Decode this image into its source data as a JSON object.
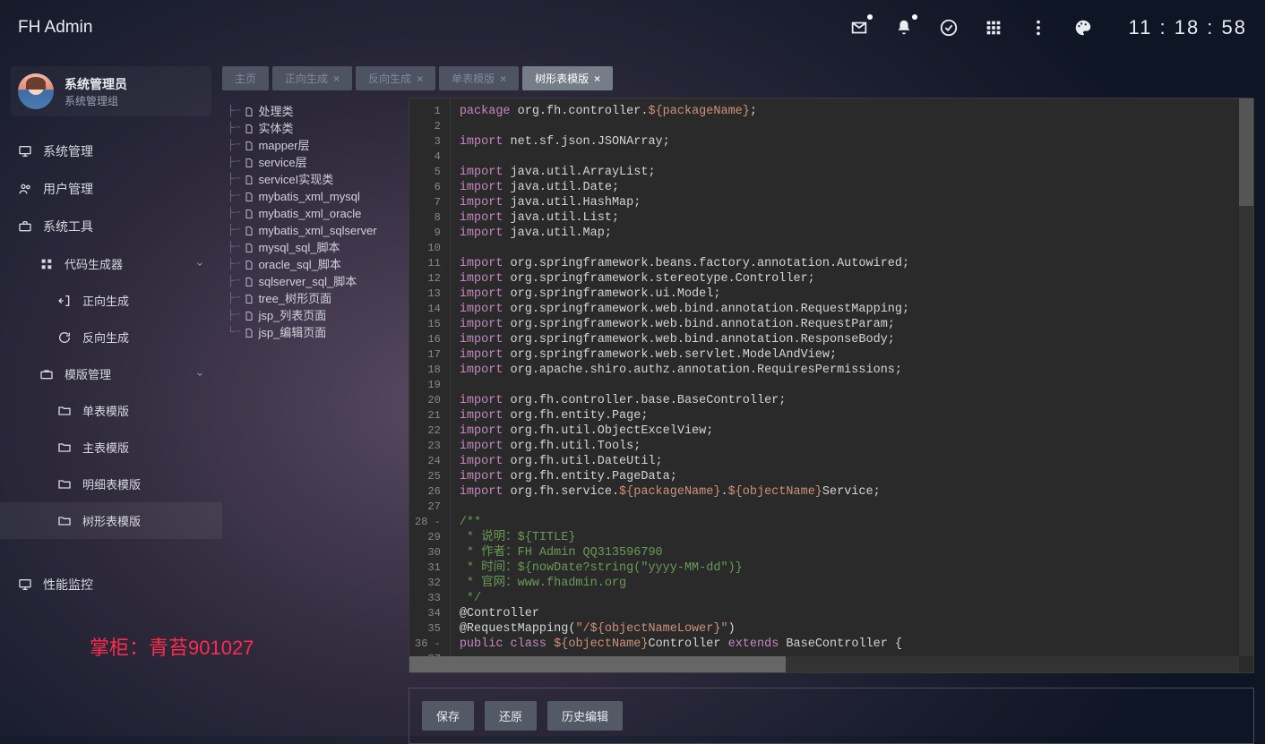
{
  "brand": "FH Admin",
  "clock": "11 : 18 : 58",
  "user": {
    "name": "系统管理员",
    "group": "系统管理组"
  },
  "nav": [
    {
      "icon": "monitor",
      "label": "系统管理"
    },
    {
      "icon": "users",
      "label": "用户管理"
    },
    {
      "icon": "briefcase",
      "label": "系统工具"
    },
    {
      "icon": "grid",
      "label": "代码生成器",
      "lvl": 2,
      "exp": true
    },
    {
      "icon": "exit",
      "label": "正向生成",
      "lvl": 3
    },
    {
      "icon": "refresh",
      "label": "反向生成",
      "lvl": 3
    },
    {
      "icon": "case",
      "label": "模版管理",
      "lvl": 2,
      "exp": true
    },
    {
      "icon": "folder",
      "label": "单表模版",
      "lvl": 3
    },
    {
      "icon": "folder",
      "label": "主表模版",
      "lvl": 3
    },
    {
      "icon": "folder",
      "label": "明细表模版",
      "lvl": 3
    },
    {
      "icon": "folder",
      "label": "树形表模版",
      "lvl": 3,
      "active": true
    },
    {
      "icon": "monitor",
      "label": "性能监控",
      "gap": true
    }
  ],
  "tabs": [
    {
      "label": "主页",
      "closable": false,
      "state": "dead"
    },
    {
      "label": "正向生成",
      "closable": true,
      "state": "dead"
    },
    {
      "label": "反向生成",
      "closable": true,
      "state": "dead"
    },
    {
      "label": "单表模版",
      "closable": true,
      "state": "dead"
    },
    {
      "label": "树形表模版",
      "closable": true,
      "state": "active"
    }
  ],
  "tree": [
    "处理类",
    "实体类",
    "mapper层",
    "service层",
    "serviceI实现类",
    "mybatis_xml_mysql",
    "mybatis_xml_oracle",
    "mybatis_xml_sqlserver",
    "mysql_sql_脚本",
    "oracle_sql_脚本",
    "sqlserver_sql_脚本",
    "tree_树形页面",
    "jsp_列表页面",
    "jsp_编辑页面"
  ],
  "code": {
    "lines": [
      [
        [
          "kw",
          "package"
        ],
        [
          "id",
          " org.fh.controller."
        ],
        [
          "tmpl",
          "${packageName}"
        ],
        [
          "id",
          ";"
        ]
      ],
      [],
      [
        [
          "kw",
          "import"
        ],
        [
          "id",
          " net.sf.json.JSONArray;"
        ]
      ],
      [],
      [
        [
          "kw",
          "import"
        ],
        [
          "id",
          " java.util.ArrayList;"
        ]
      ],
      [
        [
          "kw",
          "import"
        ],
        [
          "id",
          " java.util.Date;"
        ]
      ],
      [
        [
          "kw",
          "import"
        ],
        [
          "id",
          " java.util.HashMap;"
        ]
      ],
      [
        [
          "kw",
          "import"
        ],
        [
          "id",
          " java.util.List;"
        ]
      ],
      [
        [
          "kw",
          "import"
        ],
        [
          "id",
          " java.util.Map;"
        ]
      ],
      [],
      [
        [
          "kw",
          "import"
        ],
        [
          "id",
          " org.springframework.beans.factory.annotation.Autowired;"
        ]
      ],
      [
        [
          "kw",
          "import"
        ],
        [
          "id",
          " org.springframework.stereotype.Controller;"
        ]
      ],
      [
        [
          "kw",
          "import"
        ],
        [
          "id",
          " org.springframework.ui.Model;"
        ]
      ],
      [
        [
          "kw",
          "import"
        ],
        [
          "id",
          " org.springframework.web.bind.annotation.RequestMapping;"
        ]
      ],
      [
        [
          "kw",
          "import"
        ],
        [
          "id",
          " org.springframework.web.bind.annotation.RequestParam;"
        ]
      ],
      [
        [
          "kw",
          "import"
        ],
        [
          "id",
          " org.springframework.web.bind.annotation.ResponseBody;"
        ]
      ],
      [
        [
          "kw",
          "import"
        ],
        [
          "id",
          " org.springframework.web.servlet.ModelAndView;"
        ]
      ],
      [
        [
          "kw",
          "import"
        ],
        [
          "id",
          " org.apache.shiro.authz.annotation.RequiresPermissions;"
        ]
      ],
      [],
      [
        [
          "kw",
          "import"
        ],
        [
          "id",
          " org.fh.controller.base.BaseController;"
        ]
      ],
      [
        [
          "kw",
          "import"
        ],
        [
          "id",
          " org.fh.entity.Page;"
        ]
      ],
      [
        [
          "kw",
          "import"
        ],
        [
          "id",
          " org.fh.util.ObjectExcelView;"
        ]
      ],
      [
        [
          "kw",
          "import"
        ],
        [
          "id",
          " org.fh.util.Tools;"
        ]
      ],
      [
        [
          "kw",
          "import"
        ],
        [
          "id",
          " org.fh.util.DateUtil;"
        ]
      ],
      [
        [
          "kw",
          "import"
        ],
        [
          "id",
          " org.fh.entity.PageData;"
        ]
      ],
      [
        [
          "kw",
          "import"
        ],
        [
          "id",
          " org.fh.service."
        ],
        [
          "tmpl",
          "${packageName}"
        ],
        [
          "id",
          "."
        ],
        [
          "tmpl",
          "${objectName}"
        ],
        [
          "id",
          "Service;"
        ]
      ],
      [],
      [
        [
          "cmt",
          "/**"
        ]
      ],
      [
        [
          "cmt",
          " * 说明：${TITLE}"
        ]
      ],
      [
        [
          "cmt",
          " * 作者：FH Admin QQ313596790"
        ]
      ],
      [
        [
          "cmt",
          " * 时间：${nowDate?string(\"yyyy-MM-dd\")}"
        ]
      ],
      [
        [
          "cmt",
          " * 官网：www.fhadmin.org"
        ]
      ],
      [
        [
          "cmt",
          " */"
        ]
      ],
      [
        [
          "ann",
          "@Controller"
        ]
      ],
      [
        [
          "ann",
          "@RequestMapping("
        ],
        [
          "str",
          "\"/"
        ],
        [
          "tmpl",
          "${objectNameLower}"
        ],
        [
          "str",
          "\""
        ],
        [
          "ann",
          ")"
        ]
      ],
      [
        [
          "kw",
          "public"
        ],
        [
          "id",
          " "
        ],
        [
          "kw",
          "class"
        ],
        [
          "id",
          " "
        ],
        [
          "tmpl",
          "${objectName}"
        ],
        [
          "id",
          "Controller "
        ],
        [
          "kw",
          "extends"
        ],
        [
          "id",
          " BaseController {"
        ]
      ],
      []
    ],
    "foldLines": [
      28,
      36
    ]
  },
  "buttons": {
    "save": "保存",
    "restore": "还原",
    "history": "历史编辑"
  },
  "watermark": "掌柜：青苔901027"
}
